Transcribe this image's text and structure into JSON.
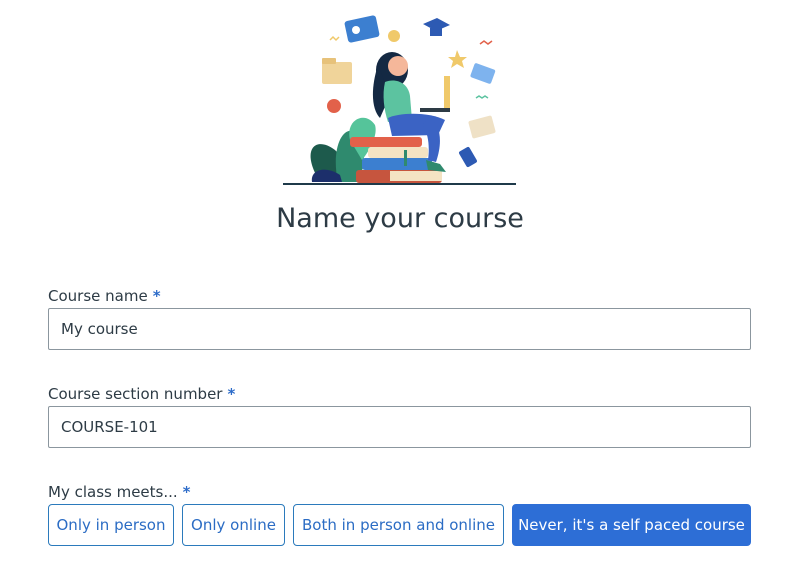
{
  "page": {
    "title": "Name your course"
  },
  "form": {
    "course_name": {
      "label": "Course name",
      "required_marker": "*",
      "value": "My course"
    },
    "section_number": {
      "label": "Course section number",
      "required_marker": "*",
      "value": "COURSE-101"
    },
    "meets": {
      "label": "My class meets...",
      "required_marker": "*",
      "options": [
        "Only in person",
        "Only online",
        "Both in person and online",
        "Never, it's a self paced course"
      ],
      "selected": "Never, it's a self paced course"
    }
  },
  "colors": {
    "accent": "#2d6ed6",
    "text": "#2d3b45",
    "border": "#8b969e"
  }
}
